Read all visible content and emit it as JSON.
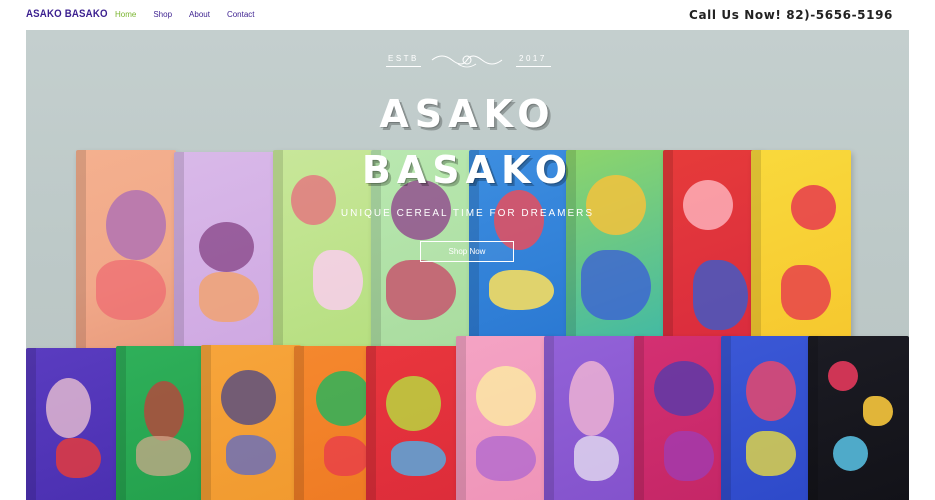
{
  "header": {
    "brand": "ASAKO BASAKO",
    "nav": [
      "Home",
      "Shop",
      "About",
      "Contact"
    ],
    "active_nav": "Home",
    "phone": "Call Us Now! 82)-5656-5196"
  },
  "hero": {
    "estb_left": "ESTB",
    "estb_right": "2017",
    "title_line1": "ASAKO",
    "title_line2": "BASAKO",
    "tagline": "UNIQUE CEREAL TIME FOR DREAMERS",
    "cta_label": "Shop Now"
  },
  "colors": {
    "brand": "#3b1f8f",
    "nav_active": "#7ab52f",
    "hero_bg": "#c4cfce"
  }
}
